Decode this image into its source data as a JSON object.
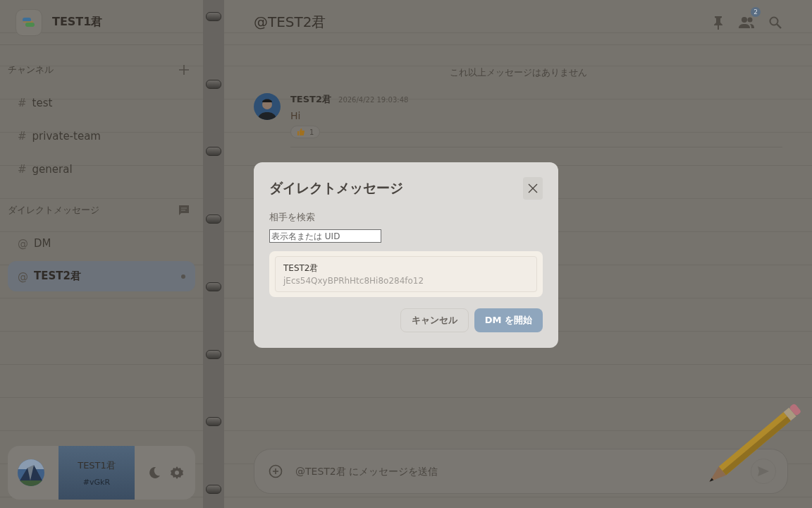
{
  "workspace": {
    "name": "TEST1君"
  },
  "sidebar": {
    "sections": [
      {
        "title": "チャンネル",
        "kind": "channels",
        "items": [
          {
            "prefix": "#",
            "label": "test",
            "selected": false,
            "unread": false
          },
          {
            "prefix": "#",
            "label": "private-team",
            "selected": false,
            "unread": false
          },
          {
            "prefix": "#",
            "label": "general",
            "selected": false,
            "unread": false
          }
        ]
      },
      {
        "title": "ダイレクトメッセージ",
        "kind": "dms",
        "items": [
          {
            "prefix": "@",
            "label": "DM",
            "selected": false,
            "unread": false
          },
          {
            "prefix": "@",
            "label": "TEST2君",
            "selected": true,
            "unread": true
          }
        ]
      }
    ]
  },
  "user_panel": {
    "name": "TEST1君",
    "tag": "#vGkR"
  },
  "chat": {
    "title": "@TEST2君",
    "member_count": "2",
    "history_notice": "これ以上メッセージはありません",
    "messages": [
      {
        "author": "TEST2君",
        "time": "2026/4/22 19:03:48",
        "text": "Hi",
        "reactions": [
          {
            "count": "1"
          }
        ]
      }
    ],
    "composer": {
      "placeholder": "@TEST2君 にメッセージを送信"
    }
  },
  "dialog": {
    "title": "ダイレクトメッセージ",
    "search_label": "相手を検索",
    "search": {
      "placeholder": "表示名または UID"
    },
    "results": [
      {
        "name": "TEST2君",
        "uid": "jEcs54QxyBPRhHtc8Hi8o284fo12"
      }
    ],
    "buttons": [
      {
        "label": "キャンセル",
        "kind": "secondary",
        "disabled": false
      },
      {
        "label": "DM を開始",
        "kind": "primary",
        "disabled": true
      }
    ]
  }
}
